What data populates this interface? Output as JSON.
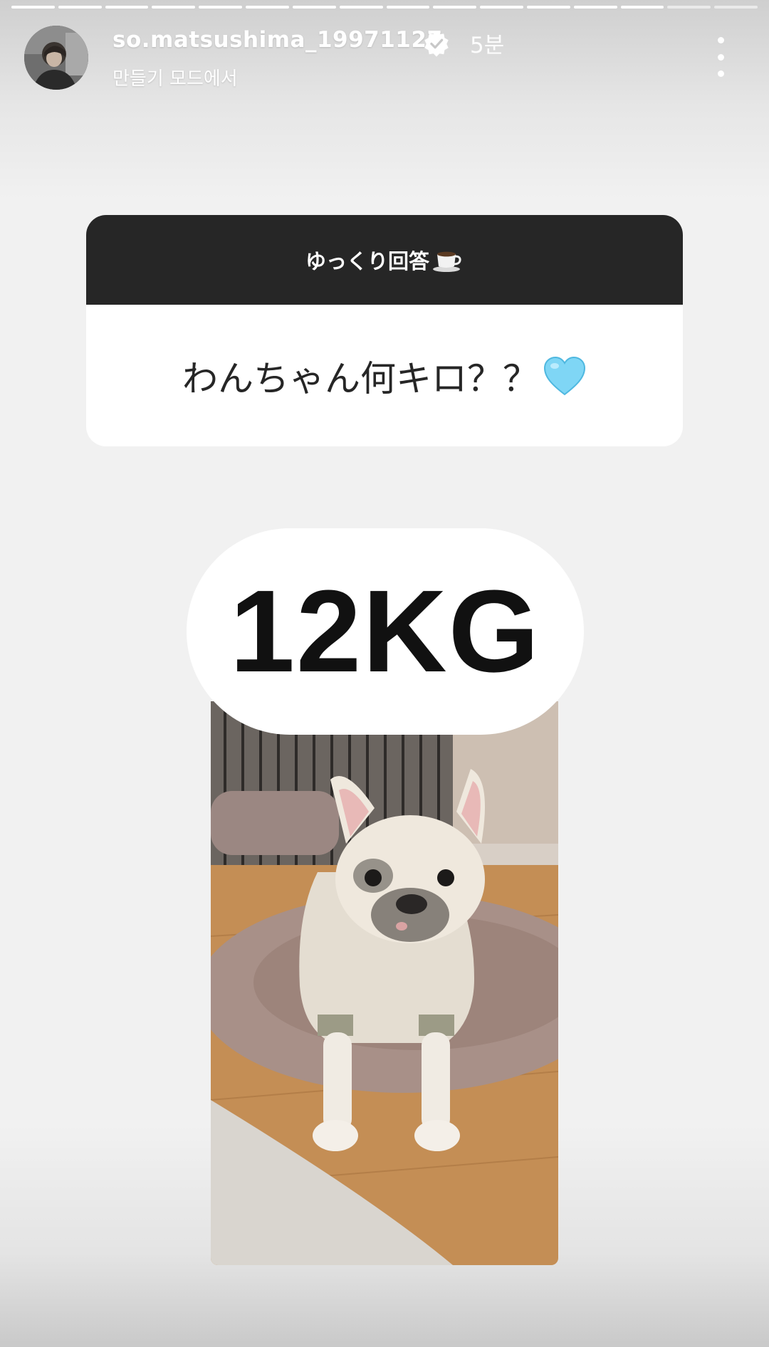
{
  "story": {
    "segments_total": 16,
    "segments_done": 14,
    "username": "so.matsushima_19971127",
    "verified": true,
    "time": "5분",
    "subtitle": "만들기 모드에서"
  },
  "question_card": {
    "header": "ゆっくり回答",
    "header_icon": "coffee-icon",
    "question": "わんちゃん何キロ？？",
    "question_icon": "light-blue-heart-icon"
  },
  "answer": {
    "text": "12KG"
  },
  "colors": {
    "card_header_bg": "#262626",
    "background": "#f1f1f1",
    "heart": "#7fd6f5"
  }
}
